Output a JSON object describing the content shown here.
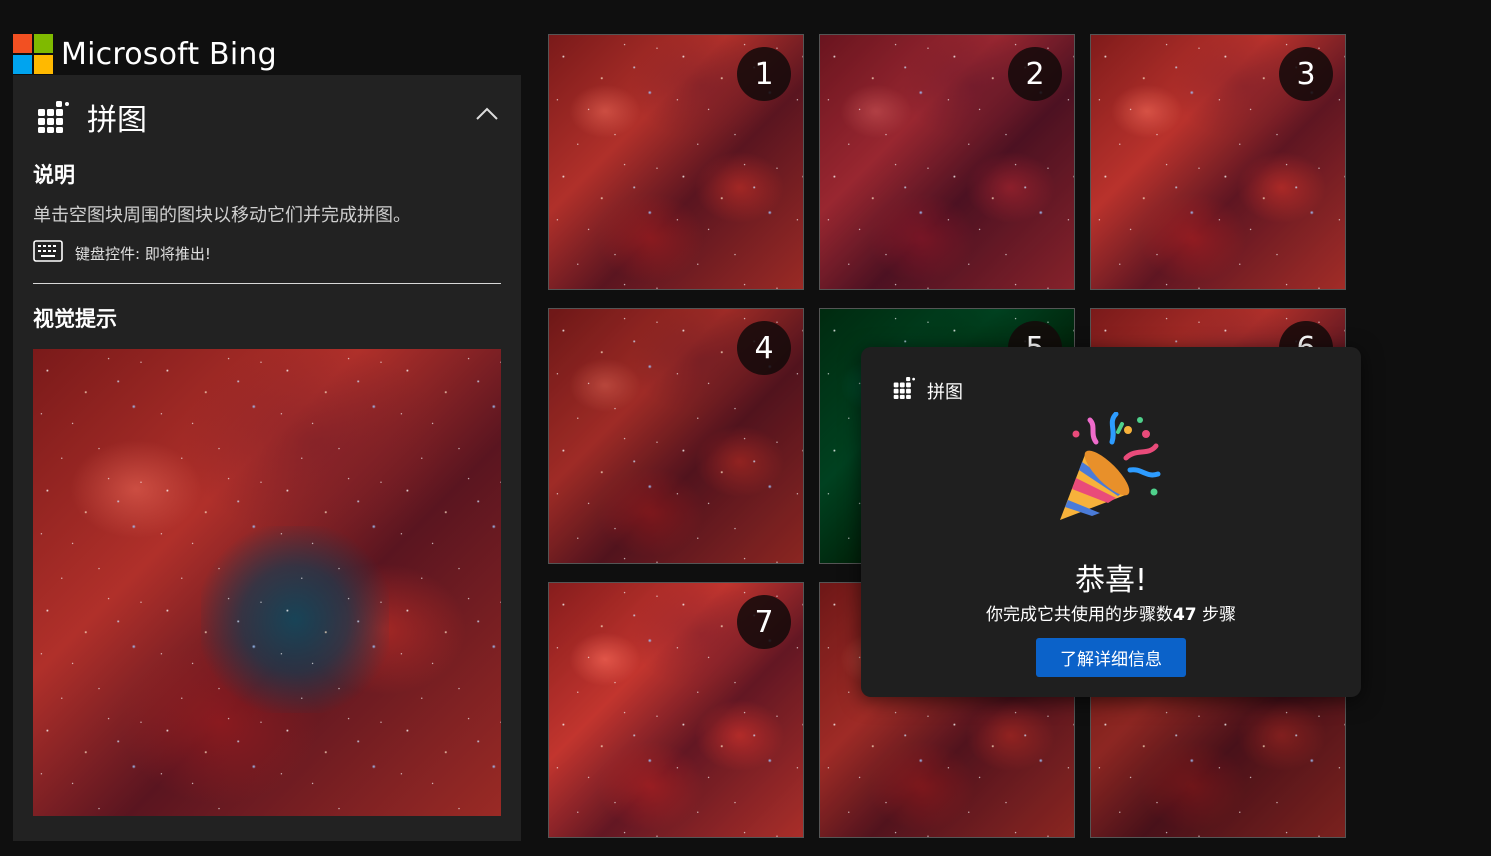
{
  "header": {
    "logo_text": "Microsoft Bing",
    "logo_colors": [
      "#f25022",
      "#7fba00",
      "#00a4ef",
      "#ffb900"
    ]
  },
  "panel": {
    "title": "拼图",
    "title_icon": "puzzle-grid-icon",
    "collapse_icon": "chevron-up-icon",
    "instructions_heading": "说明",
    "instructions_text": "单击空图块周围的图块以移动它们并完成拼图。",
    "keyboard_icon": "keyboard-icon",
    "keyboard_text": "键盘控件: 即将推出!",
    "visual_hint_heading": "视觉提示"
  },
  "puzzle": {
    "tiles": [
      {
        "label": "1"
      },
      {
        "label": "2"
      },
      {
        "label": "3"
      },
      {
        "label": "4"
      },
      {
        "label": "5"
      },
      {
        "label": "6"
      },
      {
        "label": "7"
      },
      {
        "label": ""
      },
      {
        "label": ""
      }
    ]
  },
  "dialog": {
    "title_small": "拼图",
    "celebration_icon": "party-popper-icon",
    "title": "恭喜!",
    "message_prefix": "你完成它共使用的步骤数",
    "steps": "47",
    "message_suffix": " 步骤",
    "button_label": "了解详细信息",
    "accent_color": "#0b62c9"
  }
}
